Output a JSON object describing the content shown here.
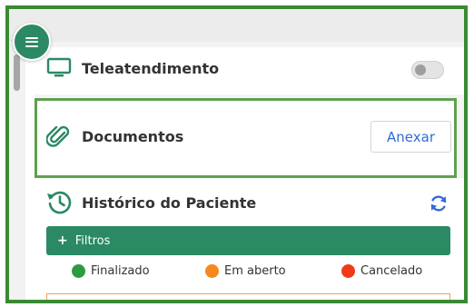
{
  "menu": {
    "icon": "menu-icon"
  },
  "teleatendimento": {
    "title": "Teleatendimento",
    "icon": "monitor-icon",
    "toggle_on": false
  },
  "documentos": {
    "title": "Documentos",
    "icon": "paperclip-icon",
    "button_label": "Anexar"
  },
  "historico": {
    "title": "Histórico do Paciente",
    "icon": "history-icon",
    "refresh_icon": "refresh-icon",
    "filters_label": "Filtros",
    "filters_plus": "+",
    "legend": [
      {
        "label": "Finalizado",
        "color": "#2e9a44"
      },
      {
        "label": "Em aberto",
        "color": "#f5891f"
      },
      {
        "label": "Cancelado",
        "color": "#f03a17"
      }
    ]
  },
  "colors": {
    "accent_green": "#2b8a63",
    "highlight_border": "#5fa04e",
    "link_blue": "#2f6bd8"
  }
}
